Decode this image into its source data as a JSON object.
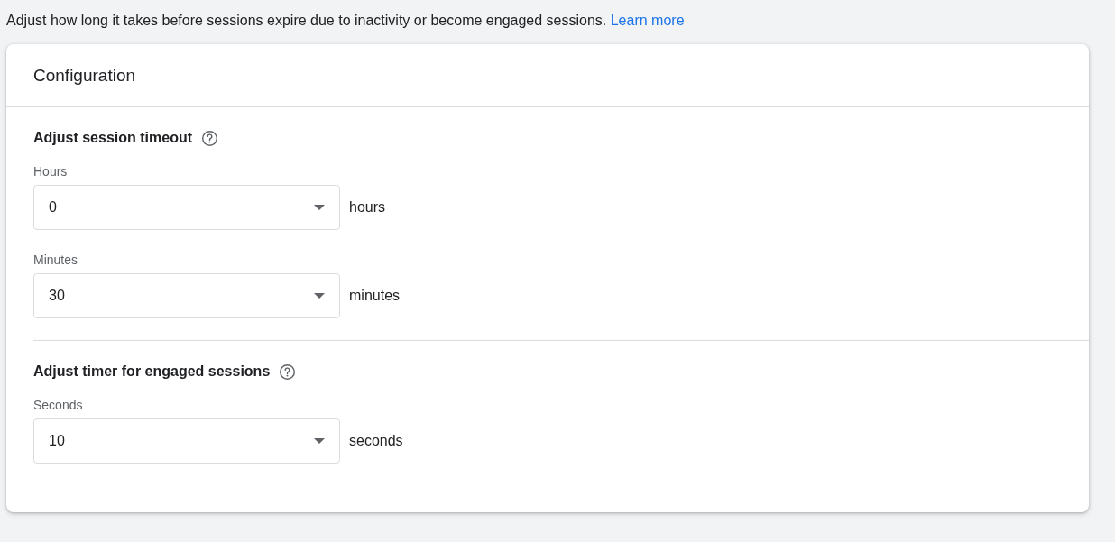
{
  "intro": {
    "text": "Adjust how long it takes before sessions expire due to inactivity or become engaged sessions.",
    "link": "Learn more"
  },
  "card": {
    "title": "Configuration",
    "sections": [
      {
        "title": "Adjust session timeout",
        "fields": [
          {
            "label": "Hours",
            "value": "0",
            "unit": "hours"
          },
          {
            "label": "Minutes",
            "value": "30",
            "unit": "minutes"
          }
        ]
      },
      {
        "title": "Adjust timer for engaged sessions",
        "fields": [
          {
            "label": "Seconds",
            "value": "10",
            "unit": "seconds"
          }
        ]
      }
    ]
  }
}
